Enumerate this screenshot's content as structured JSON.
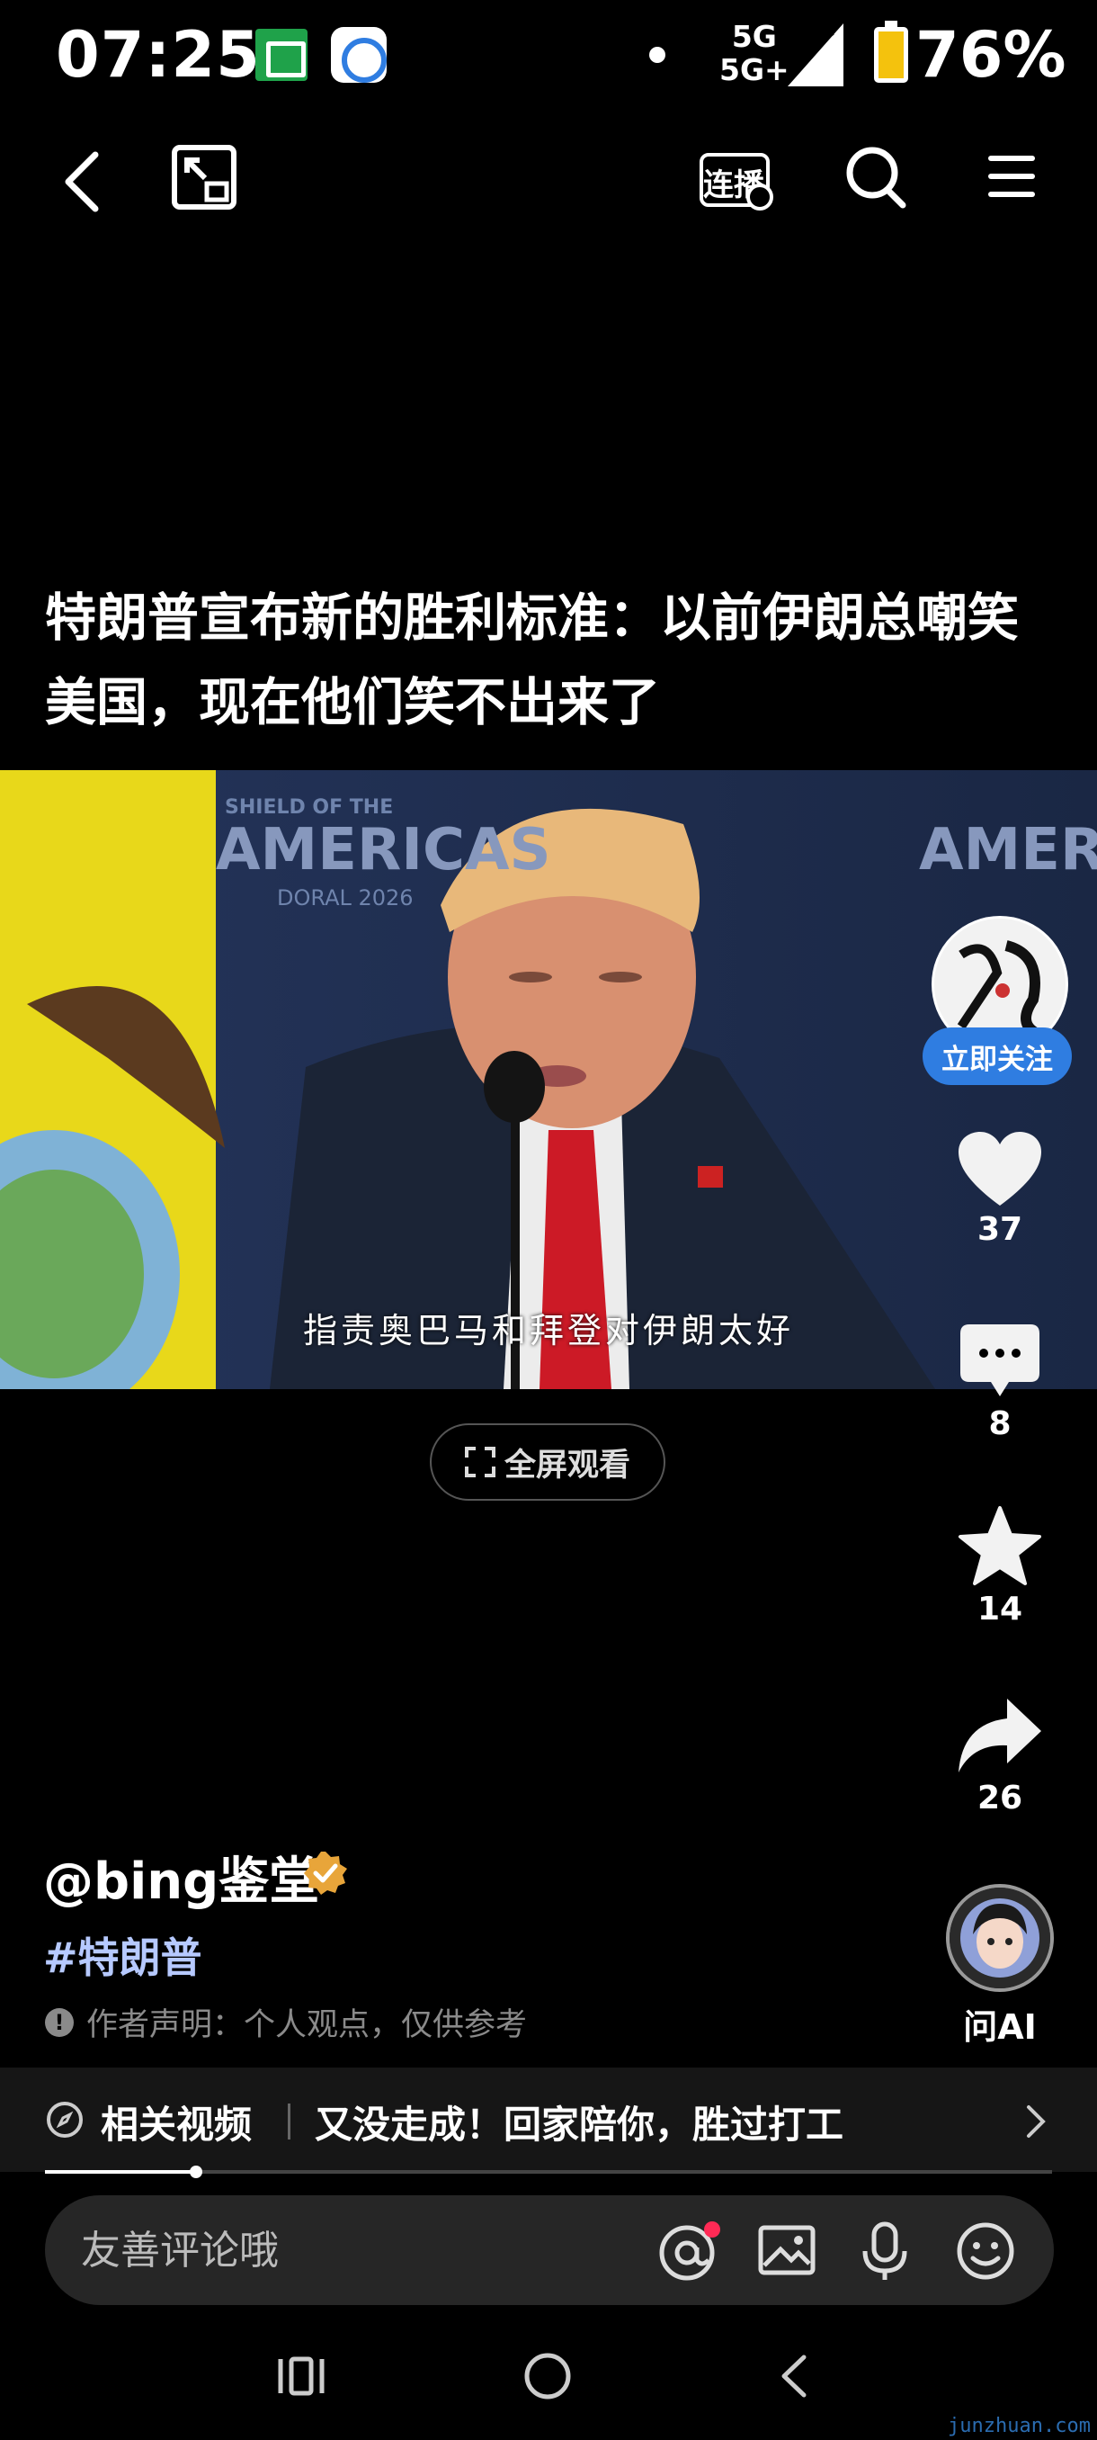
{
  "status_bar": {
    "time": "07:25",
    "network_top": "5G",
    "network_bottom": "5G+",
    "battery": "76%"
  },
  "top_nav": {
    "back": "back-icon",
    "pip": "picture-in-picture-icon",
    "cast_label": "连播",
    "search": "search-icon",
    "menu": "menu-icon"
  },
  "video": {
    "title": "特朗普宣布新的胜利标准：以前伊朗总嘲笑美国，现在他们笑不出来了",
    "backdrop_text_left": "AMERICAS",
    "backdrop_text_right": "AMERICA",
    "backdrop_sub_left": "SHIELD OF THE",
    "backdrop_sub2_left": "DORAL 2026",
    "subtitle": "指责奥巴马和拜登对伊朗太好",
    "fullscreen_label": "全屏观看"
  },
  "rail": {
    "follow_label": "立即关注",
    "likes": "37",
    "comments": "8",
    "favorites": "14",
    "shares": "26",
    "ai_label": "问AI"
  },
  "author": {
    "handle": "@bing鉴堂",
    "hashtag": "#特朗普",
    "disclaimer": "作者声明：个人观点，仅供参考"
  },
  "related": {
    "label": "相关视频",
    "title": "又没走成！回家陪你，胜过打工",
    "progress": 0.15
  },
  "comment_bar": {
    "placeholder": "友善评论哦"
  },
  "watermark": "junzhuan.com",
  "colors": {
    "accent_blue": "#2f7de1",
    "hashtag": "#b6c9ff",
    "verified": "#e8a53a",
    "notify_dot": "#ff2a55"
  }
}
